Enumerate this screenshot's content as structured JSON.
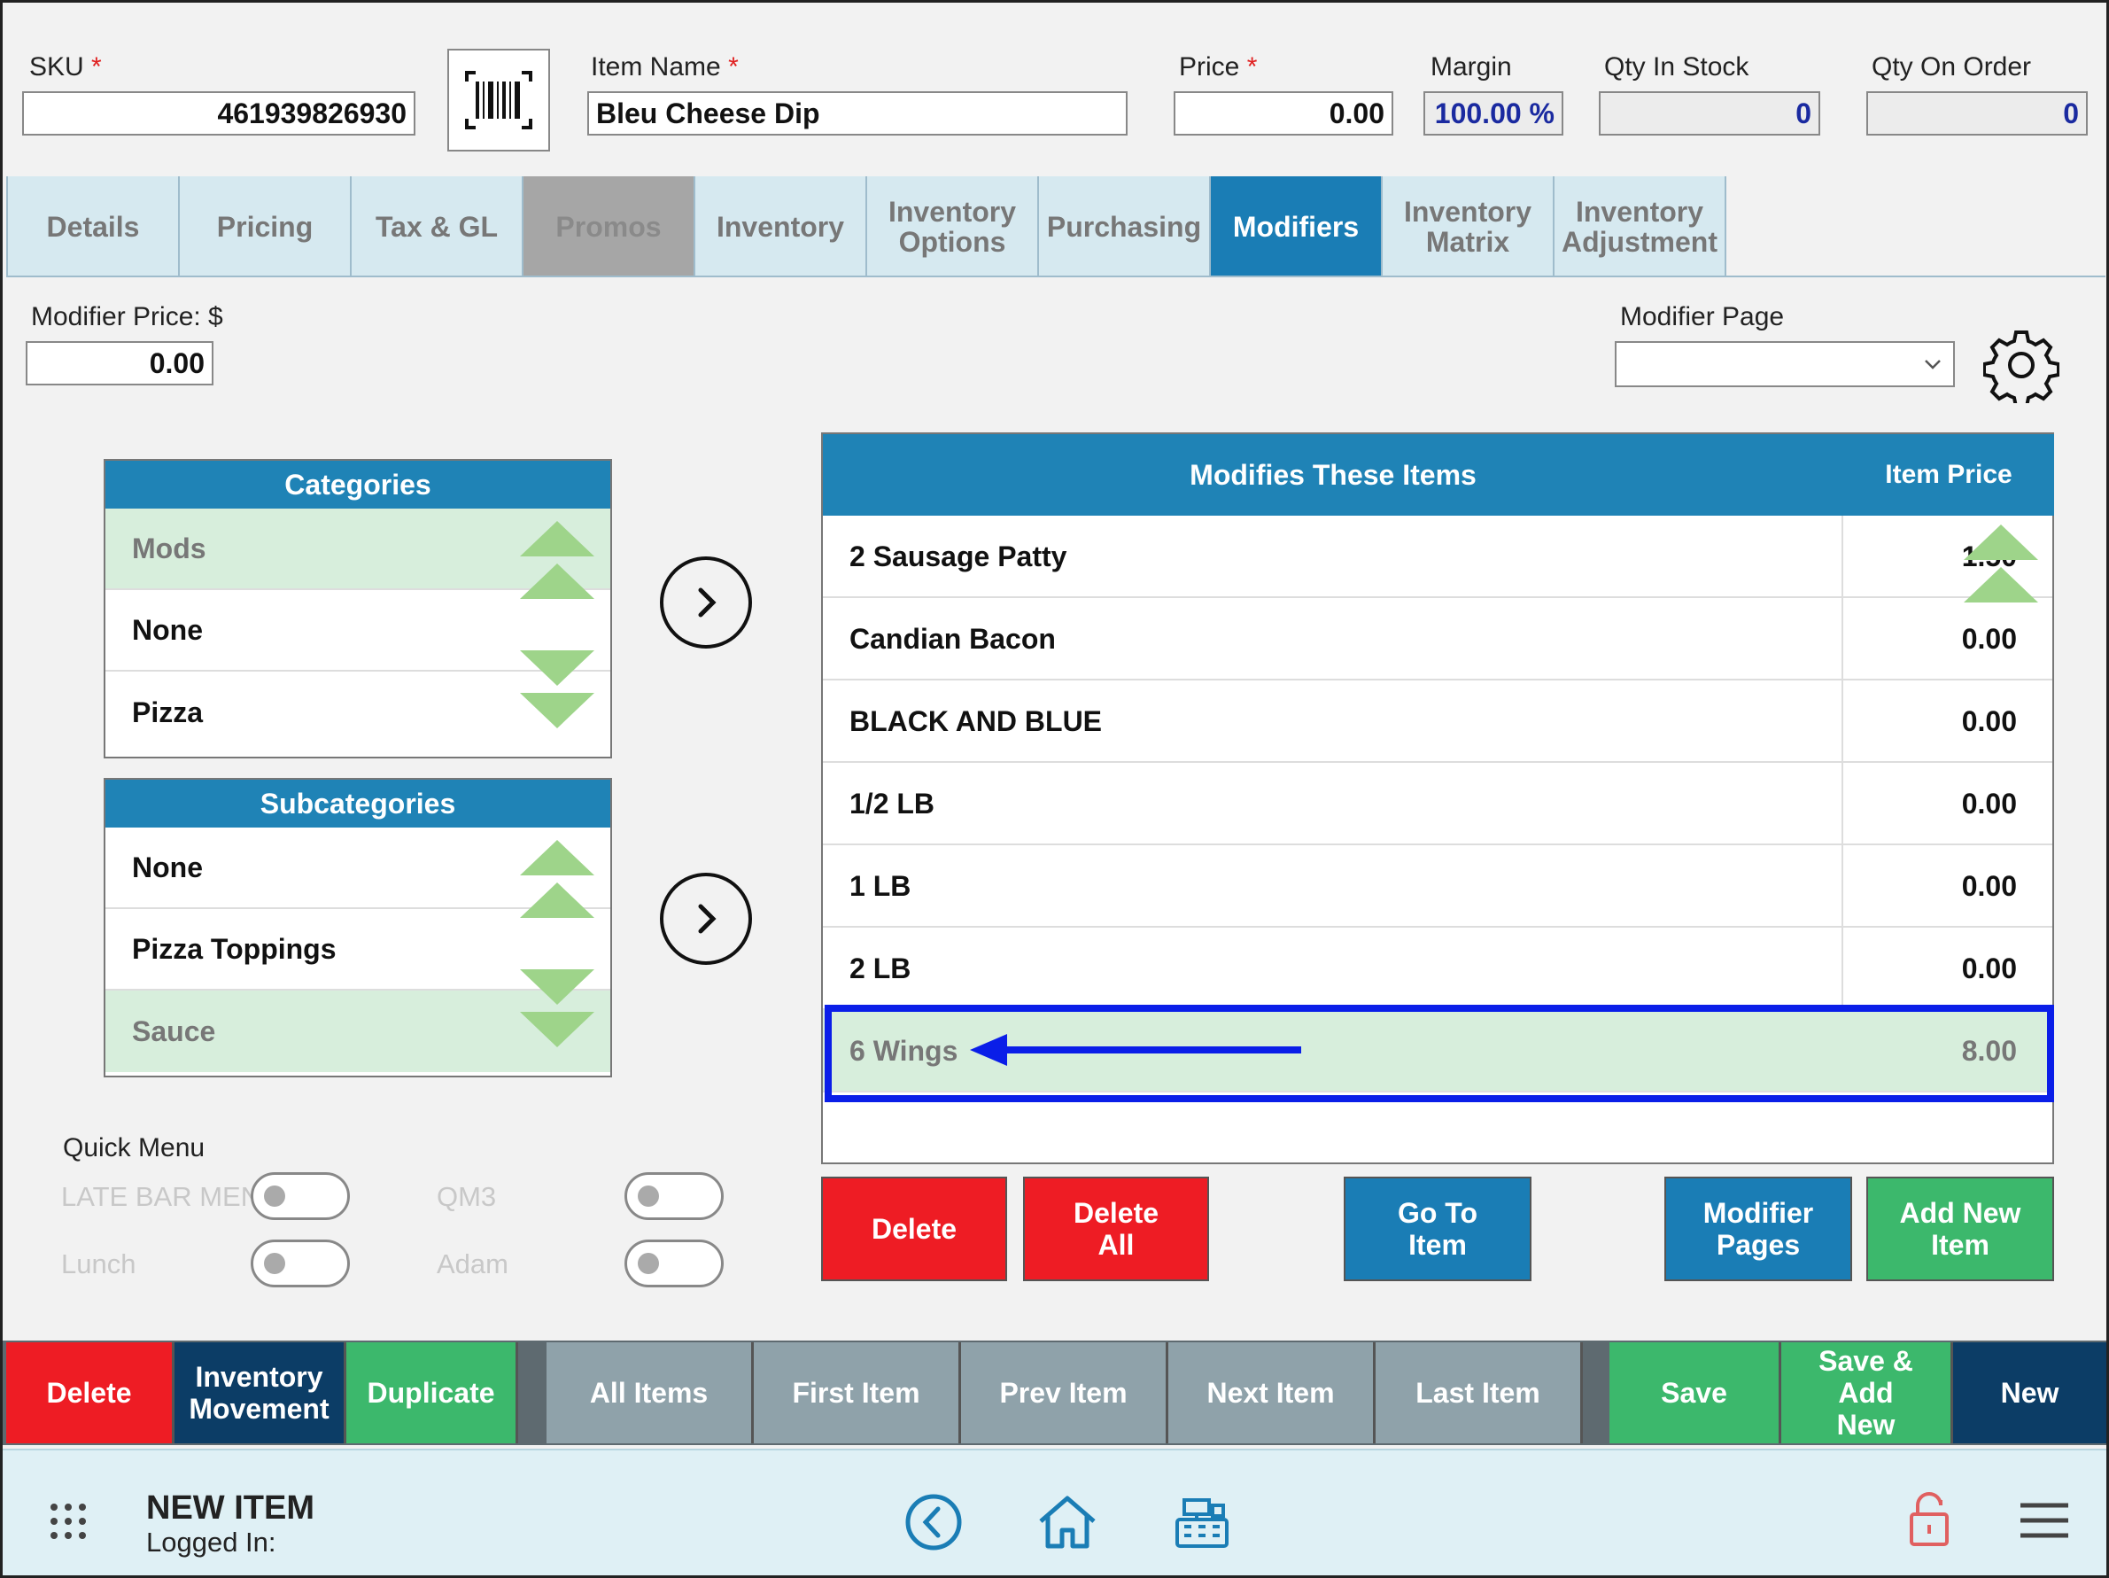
{
  "header": {
    "sku_label": "SKU",
    "sku_value": "461939826930",
    "item_name_label": "Item Name",
    "item_name_value": "Bleu Cheese Dip",
    "price_label": "Price",
    "price_value": "0.00",
    "margin_label": "Margin",
    "margin_value": "100.00 %",
    "qty_in_stock_label": "Qty In Stock",
    "qty_in_stock_value": "0",
    "qty_on_order_label": "Qty On Order",
    "qty_on_order_value": "0",
    "required_mark": "*"
  },
  "tabs": [
    {
      "label": "Details",
      "state": "normal"
    },
    {
      "label": "Pricing",
      "state": "normal"
    },
    {
      "label": "Tax & GL",
      "state": "normal"
    },
    {
      "label": "Promos",
      "state": "disabled"
    },
    {
      "label": "Inventory",
      "state": "normal"
    },
    {
      "label": "Inventory Options",
      "state": "normal"
    },
    {
      "label": "Purchasing",
      "state": "normal"
    },
    {
      "label": "Modifiers",
      "state": "active"
    },
    {
      "label": "Inventory Matrix",
      "state": "normal"
    },
    {
      "label": "Inventory Adjustment",
      "state": "normal"
    }
  ],
  "modifier_price": {
    "label": "Modifier Price: $",
    "value": "0.00"
  },
  "modifier_page": {
    "label": "Modifier Page",
    "value": ""
  },
  "categories": {
    "title": "Categories",
    "items": [
      "Mods",
      "None",
      "Pizza"
    ],
    "selected": "Mods"
  },
  "subcategories": {
    "title": "Subcategories",
    "items": [
      "None",
      "Pizza Toppings",
      "Sauce"
    ],
    "selected": "Sauce"
  },
  "modifies": {
    "title": "Modifies These Items",
    "price_header": "Item Price",
    "rows": [
      {
        "name": "2 Sausage Patty",
        "price": "1.50"
      },
      {
        "name": "Candian Bacon",
        "price": "0.00"
      },
      {
        "name": "BLACK AND BLUE",
        "price": "0.00"
      },
      {
        "name": "1/2 LB",
        "price": "0.00"
      },
      {
        "name": "1 LB",
        "price": "0.00"
      },
      {
        "name": "2 LB",
        "price": "0.00"
      },
      {
        "name": "6 Wings",
        "price": "8.00"
      }
    ],
    "selected": "6 Wings"
  },
  "quick_menu": {
    "title": "Quick Menu",
    "items": [
      "LATE BAR MENU",
      "QM3",
      "Lunch",
      "Adam"
    ]
  },
  "action_buttons": {
    "delete": "Delete",
    "delete_all": "Delete All",
    "go_to_item": "Go To Item",
    "modifier_pages": "Modifier Pages",
    "add_new_item": "Add New Item"
  },
  "bottom_bar": {
    "delete": "Delete",
    "inventory_movement": "Inventory Movement",
    "duplicate": "Duplicate",
    "all_items": "All Items",
    "first_item": "First Item",
    "prev_item": "Prev Item",
    "next_item": "Next Item",
    "last_item": "Last Item",
    "save": "Save",
    "save_add_new": "Save & Add New",
    "new": "New"
  },
  "footer": {
    "title": "NEW ITEM",
    "logged_in": "Logged In:"
  },
  "colors": {
    "accent_blue": "#1a7db5",
    "danger_red": "#ee1c24",
    "success_green": "#3cb86c",
    "navy": "#0c3d66",
    "selected_row": "#d7eedc",
    "highlight_outline": "#0a1ee8"
  }
}
